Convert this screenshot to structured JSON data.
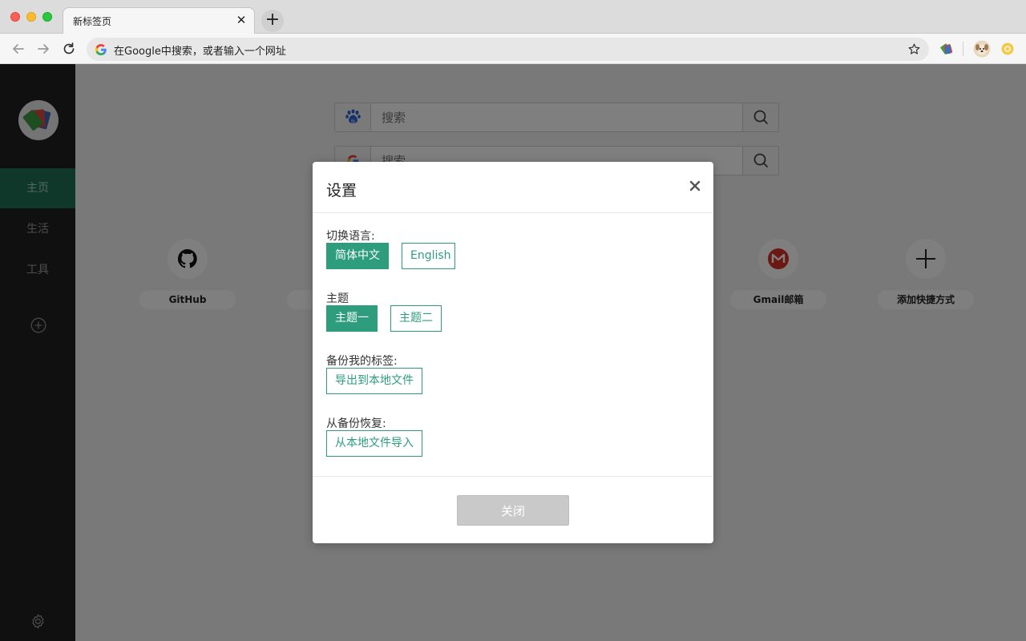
{
  "browser": {
    "tab_title": "新标签页",
    "tab_close_glyph": "✕",
    "new_tab_glyph": "+",
    "omnibox_text": "在Google中搜索，或者输入一个网址"
  },
  "sidebar": {
    "items": [
      {
        "label": "主页",
        "active": true
      },
      {
        "label": "生活",
        "active": false
      },
      {
        "label": "工具",
        "active": false
      }
    ]
  },
  "main": {
    "search_engines": [
      {
        "engine": "baidu",
        "placeholder": "搜索"
      },
      {
        "engine": "google",
        "placeholder": "搜索"
      }
    ],
    "shortcuts": [
      {
        "label": "GitHub",
        "icon": "github-icon"
      },
      {
        "label": "",
        "icon": ""
      },
      {
        "label": "Gmail邮箱",
        "icon": "gmail-icon"
      },
      {
        "label": "添加快捷方式",
        "icon": "plus-icon"
      }
    ]
  },
  "modal": {
    "title": "设置",
    "language_label": "切换语言:",
    "language_options": [
      "简体中文",
      "English"
    ],
    "selected_language": "简体中文",
    "theme_label": "主题",
    "theme_options": [
      "主题一",
      "主题二"
    ],
    "selected_theme": "主题一",
    "backup_label": "备份我的标签:",
    "backup_button": "导出到本地文件",
    "restore_label": "从备份恢复:",
    "restore_button": "从本地文件导入",
    "close_button": "关闭"
  },
  "colors": {
    "accent": "#2e9d7d",
    "sidebar_bg": "#212121",
    "sidebar_active": "#1f6e55",
    "overlay": "rgba(0,0,0,0.5)",
    "disabled_button": "#c9c9c9"
  }
}
